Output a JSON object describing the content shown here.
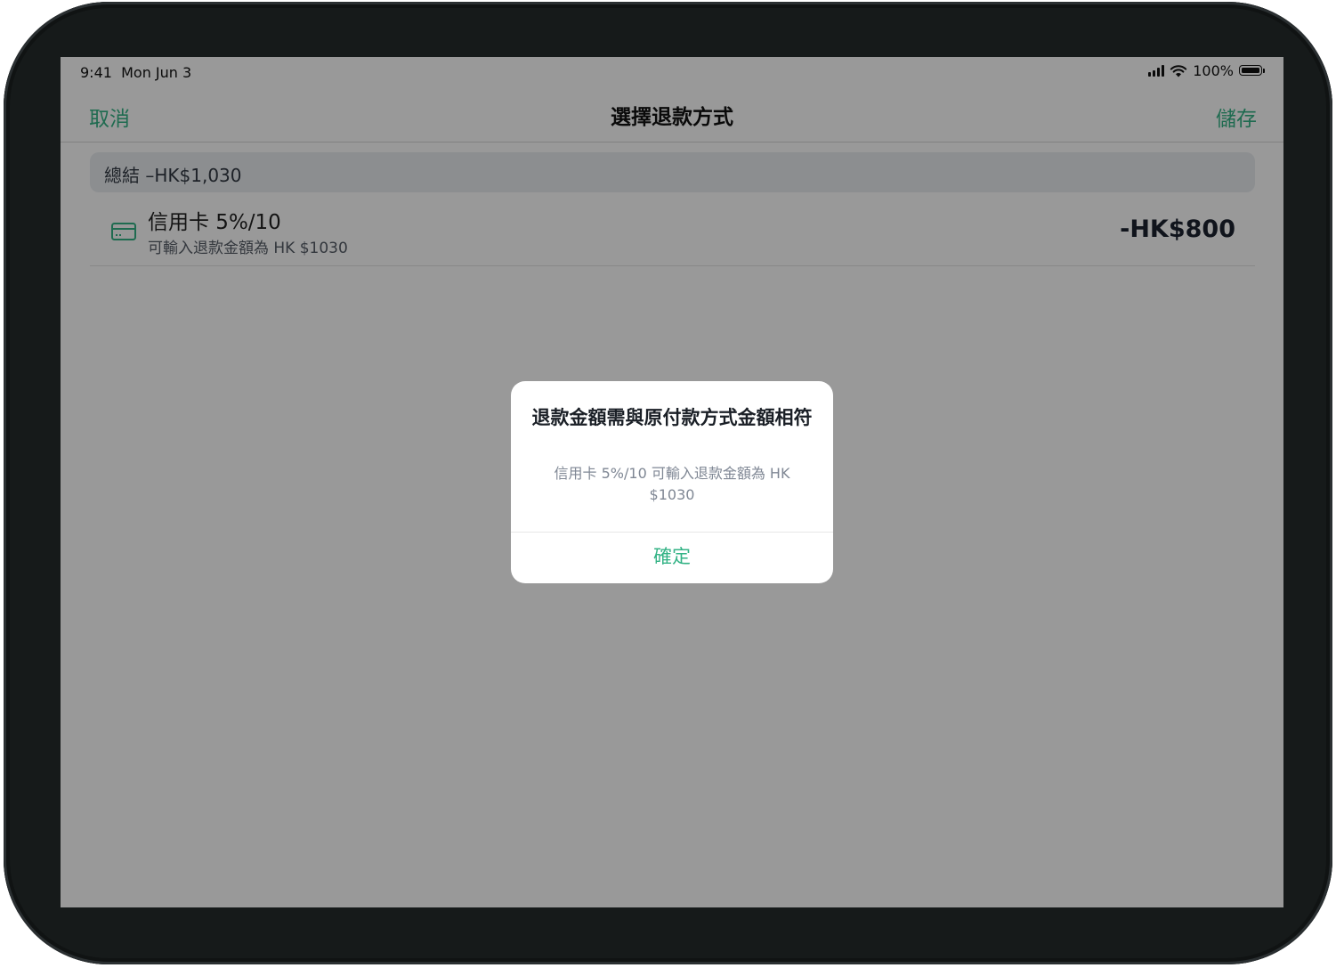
{
  "status_bar": {
    "time": "9:41",
    "date": "Mon Jun 3",
    "battery_percent": "100%",
    "battery_level": 1.0,
    "icons": [
      "signal-icon",
      "wifi-icon",
      "battery-icon"
    ]
  },
  "nav": {
    "cancel_label": "取消",
    "title": "選擇退款方式",
    "save_label": "儲存"
  },
  "summary": {
    "text": "總結 –HK$1,030"
  },
  "payment": {
    "icon": "credit-card-icon",
    "name": "信用卡 5%/10",
    "subtitle": "可輸入退款金額為 HK $1030",
    "amount": "-HK$800"
  },
  "alert": {
    "title": "退款金額需與原付款方式金額相符",
    "message": "信用卡 5%/10 可輸入退款金額為 HK $1030",
    "confirm_label": "確定"
  },
  "colors": {
    "accent": "#34b386",
    "overlay": "rgba(0,0,0,0.40)",
    "summary_bg": "#e9edf1"
  }
}
